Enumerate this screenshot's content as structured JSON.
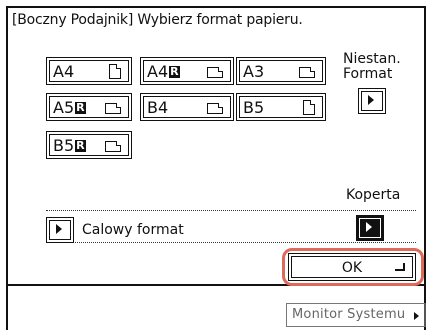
{
  "title": "[Boczny Podajnik] Wybierz format papieru.",
  "paper_sizes": [
    {
      "label": "A4",
      "suffix": "",
      "orientation": "portrait"
    },
    {
      "label": "A4",
      "suffix": "R",
      "orientation": "landscape"
    },
    {
      "label": "A3",
      "suffix": "",
      "orientation": "landscape"
    },
    {
      "label": "A5",
      "suffix": "R",
      "orientation": "landscape"
    },
    {
      "label": "B4",
      "suffix": "",
      "orientation": "landscape"
    },
    {
      "label": "B5",
      "suffix": "",
      "orientation": "portrait"
    },
    {
      "label": "B5",
      "suffix": "R",
      "orientation": "landscape"
    }
  ],
  "nonstandard": {
    "line1": "Niestan.",
    "line2": "Format"
  },
  "envelope": {
    "label": "Koperta"
  },
  "inch_format": {
    "label": "Calowy format"
  },
  "ok_button": {
    "label": "OK"
  },
  "monitor_button": {
    "label": "Monitor Systemu"
  }
}
